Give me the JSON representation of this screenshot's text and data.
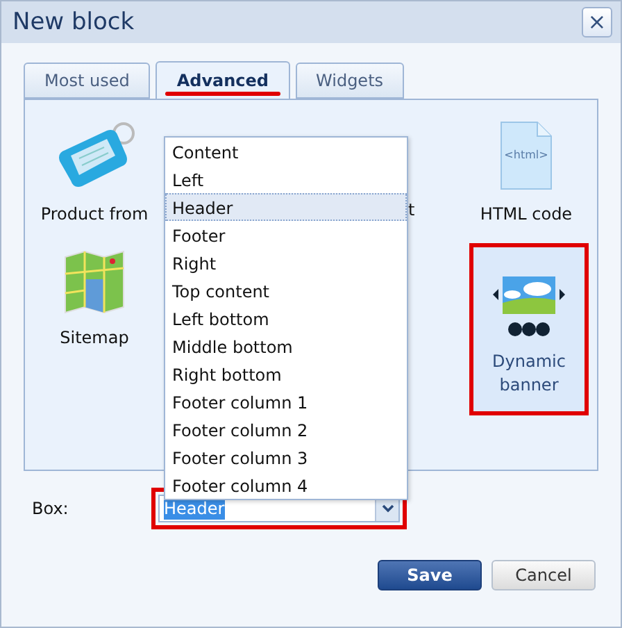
{
  "window": {
    "title": "New block",
    "close": "×"
  },
  "tabs": [
    {
      "label": "Most used",
      "selected": false
    },
    {
      "label": "Advanced",
      "selected": true
    },
    {
      "label": "Widgets",
      "selected": false
    }
  ],
  "tiles": [
    [
      {
        "kind": "tag",
        "label": "Product from",
        "selected": false
      },
      {
        "kind": "cut",
        "label": "t",
        "selected": false
      },
      {
        "kind": "html",
        "icon_text": "<html>",
        "label": "HTML code",
        "selected": false
      }
    ],
    [
      {
        "kind": "map",
        "label": "Sitemap",
        "selected": false
      },
      {
        "kind": "banner",
        "label": "Dynamic banner",
        "selected": true
      }
    ]
  ],
  "dropdown": {
    "open": true,
    "options": [
      {
        "label": "Content",
        "selected": false
      },
      {
        "label": "Left",
        "selected": false
      },
      {
        "label": "Header",
        "selected": true
      },
      {
        "label": "Footer",
        "selected": false
      },
      {
        "label": "Right",
        "selected": false
      },
      {
        "label": "Top content",
        "selected": false
      },
      {
        "label": "Left bottom",
        "selected": false
      },
      {
        "label": "Middle bottom",
        "selected": false
      },
      {
        "label": "Right bottom",
        "selected": false
      },
      {
        "label": "Footer column 1",
        "selected": false
      },
      {
        "label": "Footer column 2",
        "selected": false
      },
      {
        "label": "Footer column 3",
        "selected": false
      },
      {
        "label": "Footer column 4",
        "selected": false
      }
    ]
  },
  "box": {
    "label": "Box:",
    "value": "Header",
    "highlighted": true
  },
  "buttons": [
    {
      "label": "Save",
      "kind": "primary"
    },
    {
      "label": "Cancel",
      "kind": "secondary"
    }
  ]
}
